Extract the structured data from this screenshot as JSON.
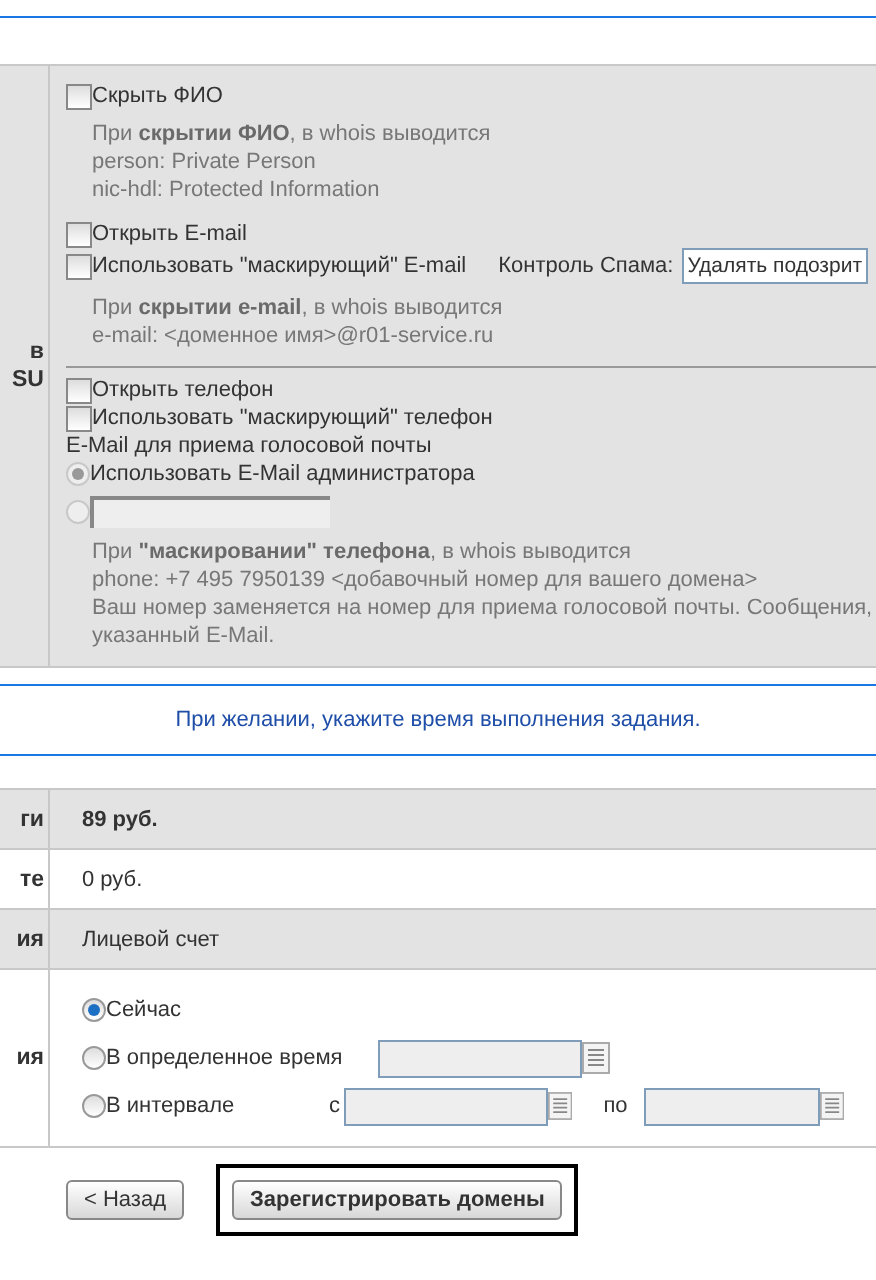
{
  "privacy_section": {
    "side_label": [
      "в",
      "SU"
    ],
    "items": [
      {
        "kind": "checkbox",
        "label": "Скрыть ФИО",
        "checked": false
      },
      {
        "kind": "note",
        "lines": [
          "При **скрытии ФИО**, в whois выводится",
          "person: Private Person",
          "nic-hdl: Protected Information"
        ]
      },
      {
        "kind": "checkbox",
        "label": "Открыть E-mail",
        "checked": false
      },
      {
        "kind": "checkbox",
        "label": "Использовать \"маскирующий\" E-mail",
        "checked": false,
        "spam_control": {
          "label": "Контроль Спама:",
          "value": "Удалять подозрит"
        }
      },
      {
        "kind": "note",
        "lines": [
          "При **скрытии e-mail**, в whois выводится",
          "e-mail:  <доменное имя>@r01-service.ru"
        ]
      },
      {
        "kind": "divider"
      },
      {
        "kind": "checkbox",
        "label": "Открыть телефон",
        "checked": false
      },
      {
        "kind": "checkbox",
        "label": "Использовать \"маскирующий\" телефон",
        "checked": false
      },
      {
        "kind": "label",
        "text": "E-Mail для приема голосовой почты"
      },
      {
        "kind": "radio",
        "label": "Использовать E-Mail администратора",
        "selected": true,
        "disabled": true
      },
      {
        "kind": "radio_input",
        "selected": false,
        "disabled": true
      },
      {
        "kind": "note",
        "lines": [
          "При **\"маскировании\" телефона**, в whois выводится",
          "phone: +7 495 7950139 <добавочный номер для вашего домена>",
          "Ваш номер заменяется на номер для приема голосовой почты. Сообщения,",
          "указанный E-Mail."
        ]
      }
    ]
  },
  "banner": "При желании, укажите время выполнения задания.",
  "summary_rows": [
    {
      "label": "ги",
      "kind": "text",
      "value": "89 руб.",
      "bold": true
    },
    {
      "label": "те",
      "kind": "text",
      "value": "0 руб.",
      "bold": false
    },
    {
      "label": "ия",
      "kind": "text",
      "value": "Лицевой счет",
      "bold": false
    },
    {
      "label": "ия",
      "kind": "schedule",
      "options": [
        {
          "kind": "plain",
          "label": "Сейчас",
          "selected": true
        },
        {
          "kind": "datetime",
          "label": "В определенное время",
          "selected": false
        },
        {
          "kind": "interval",
          "label": "В интервале",
          "selected": false,
          "from_label": "с",
          "to_label": "по"
        }
      ]
    }
  ],
  "buttons": [
    {
      "kind": "back",
      "label": "< Назад",
      "focused": false
    },
    {
      "kind": "submit",
      "label": "Зарегистрировать домены",
      "focused": true
    }
  ]
}
